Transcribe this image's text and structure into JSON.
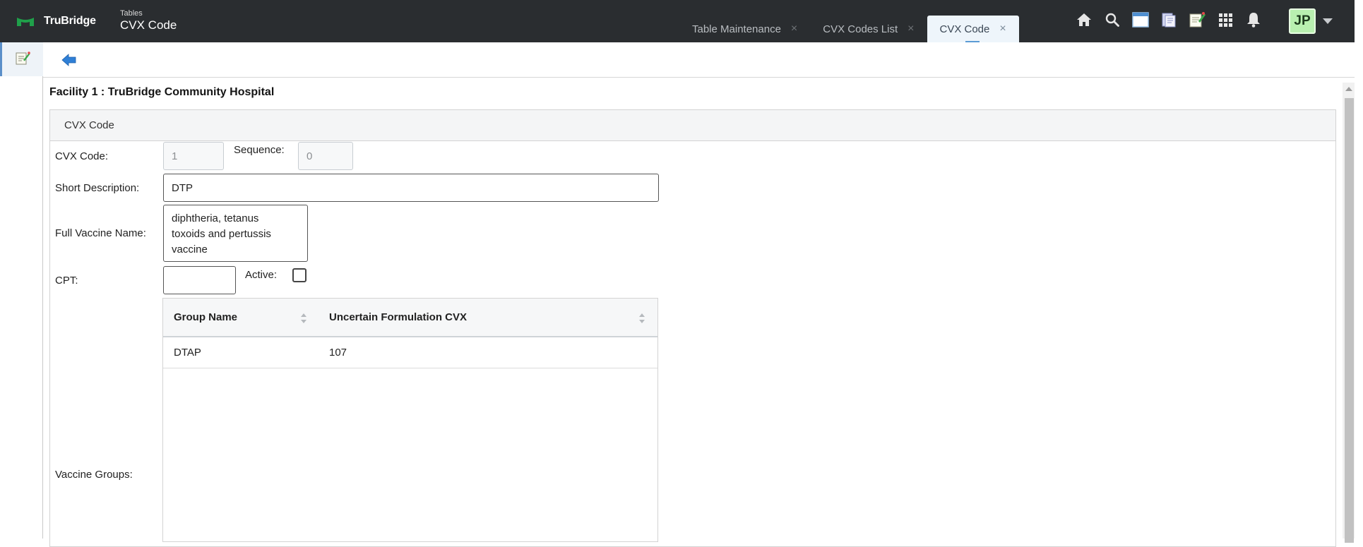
{
  "brand": {
    "name": "TruBridge"
  },
  "header": {
    "section": "Tables",
    "title": "CVX Code"
  },
  "tabs": [
    {
      "label": "Table Maintenance",
      "close": "×"
    },
    {
      "label": "CVX Codes List",
      "close": "×"
    },
    {
      "label": "CVX Code",
      "close": "×"
    }
  ],
  "top_icons": [
    "home-icon",
    "search-icon",
    "window-icon",
    "documents-icon",
    "notes-icon",
    "app-grid-icon",
    "bell-icon"
  ],
  "user": {
    "initials": "JP"
  },
  "facility": "Facility 1 : TruBridge Community Hospital",
  "panel": {
    "title": "CVX Code"
  },
  "form": {
    "cvx_code_label": "CVX Code:",
    "cvx_code_value": "1",
    "sequence_label": "Sequence:",
    "sequence_value": "0",
    "short_desc_label": "Short Description:",
    "short_desc_value": "DTP",
    "full_name_label": "Full Vaccine Name:",
    "full_name_value": "diphtheria, tetanus\ntoxoids and pertussis\nvaccine",
    "cpt_label": "CPT:",
    "cpt_value": "",
    "active_label": "Active:",
    "active_checked": false,
    "vaccine_groups_label": "Vaccine Groups:"
  },
  "vaccine_groups": {
    "columns": [
      "Group Name",
      "Uncertain Formulation CVX"
    ],
    "rows": [
      [
        "DTAP",
        "107"
      ]
    ]
  },
  "colors": {
    "topbar": "#2a2d30",
    "brand_green": "#1fa04a",
    "accent_blue": "#5b9bd5",
    "avatar_green": "#b9f0b0"
  }
}
